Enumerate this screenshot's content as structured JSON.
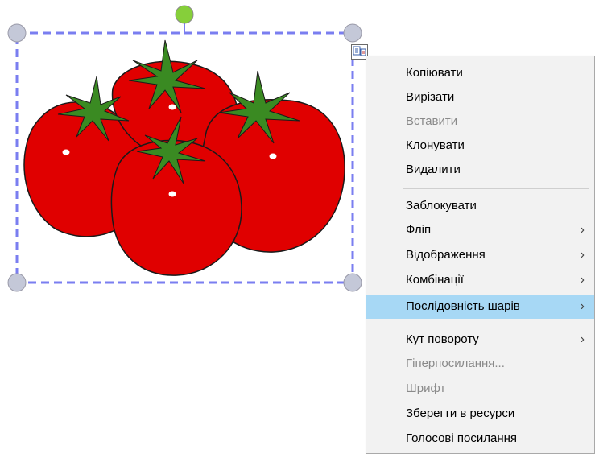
{
  "canvas": {
    "object": "tomatoes-clipart",
    "selection_color": "#7a7ef0",
    "rotate_handle_color": "#86cf3a",
    "corner_handle_color": "#c4c8d8",
    "tomato_color": "#e00000",
    "leaf_color": "#3a8a22"
  },
  "menu_anchor_icon": "object-menu-icon",
  "context_menu": {
    "items": [
      {
        "label": "Копіювати",
        "enabled": true,
        "submenu": false
      },
      {
        "label": "Вирізати",
        "enabled": true,
        "submenu": false
      },
      {
        "label": "Вставити",
        "enabled": false,
        "submenu": false
      },
      {
        "label": "Клонувати",
        "enabled": true,
        "submenu": false
      },
      {
        "label": "Видалити",
        "enabled": true,
        "submenu": false
      },
      {
        "label": "Заблокувати",
        "enabled": true,
        "submenu": false
      },
      {
        "label": "Фліп",
        "enabled": true,
        "submenu": true
      },
      {
        "label": "Відображення",
        "enabled": true,
        "submenu": true
      },
      {
        "label": "Комбінації",
        "enabled": true,
        "submenu": true
      },
      {
        "label": "Послідовність шарів",
        "enabled": true,
        "submenu": true,
        "highlighted": true
      },
      {
        "label": "Кут повороту",
        "enabled": true,
        "submenu": true
      },
      {
        "label": "Гіперпосилання...",
        "enabled": false,
        "submenu": false
      },
      {
        "label": "Шрифт",
        "enabled": false,
        "submenu": false
      },
      {
        "label": "Зберегти в ресурси",
        "enabled": true,
        "submenu": false
      },
      {
        "label": "Голосові посилання",
        "enabled": true,
        "submenu": false
      }
    ],
    "submenu_arrow": "›",
    "highlight_color": "#a7d8f5"
  }
}
